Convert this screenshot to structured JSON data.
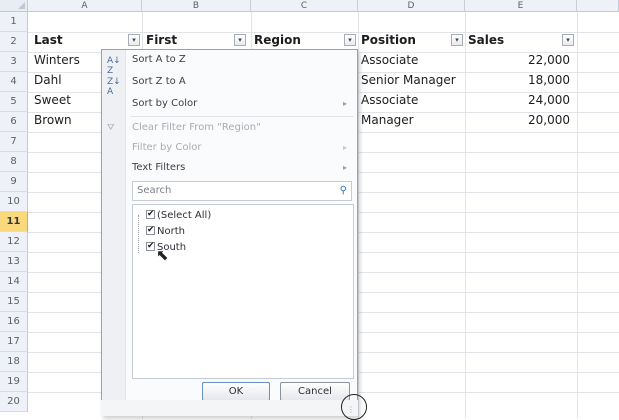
{
  "columns": [
    "A",
    "B",
    "C",
    "D",
    "E"
  ],
  "rows": [
    "1",
    "2",
    "3",
    "4",
    "5",
    "6",
    "7",
    "8",
    "9",
    "10",
    "11",
    "12",
    "13",
    "14",
    "15",
    "16",
    "17",
    "18",
    "19",
    "20"
  ],
  "active_row": "11",
  "headers": {
    "last": "Last",
    "first": "First",
    "region": "Region",
    "position": "Position",
    "sales": "Sales"
  },
  "data_rows": [
    {
      "last": "Winters",
      "position": "Associate",
      "sales": "22,000"
    },
    {
      "last": "Dahl",
      "position": "Senior Manager",
      "sales": "18,000"
    },
    {
      "last": "Sweet",
      "position": "Associate",
      "sales": "24,000"
    },
    {
      "last": "Brown",
      "position": "Manager",
      "sales": "20,000"
    }
  ],
  "filter_menu": {
    "sort_a_to_z": "Sort A to Z",
    "sort_z_to_a": "Sort Z to A",
    "sort_by_color": "Sort by Color",
    "clear_filter": "Clear Filter From \"Region\"",
    "filter_by_color": "Filter by Color",
    "text_filters": "Text Filters",
    "search_placeholder": "Search",
    "items": [
      "(Select All)",
      "North",
      "South"
    ],
    "ok": "OK",
    "cancel": "Cancel"
  }
}
